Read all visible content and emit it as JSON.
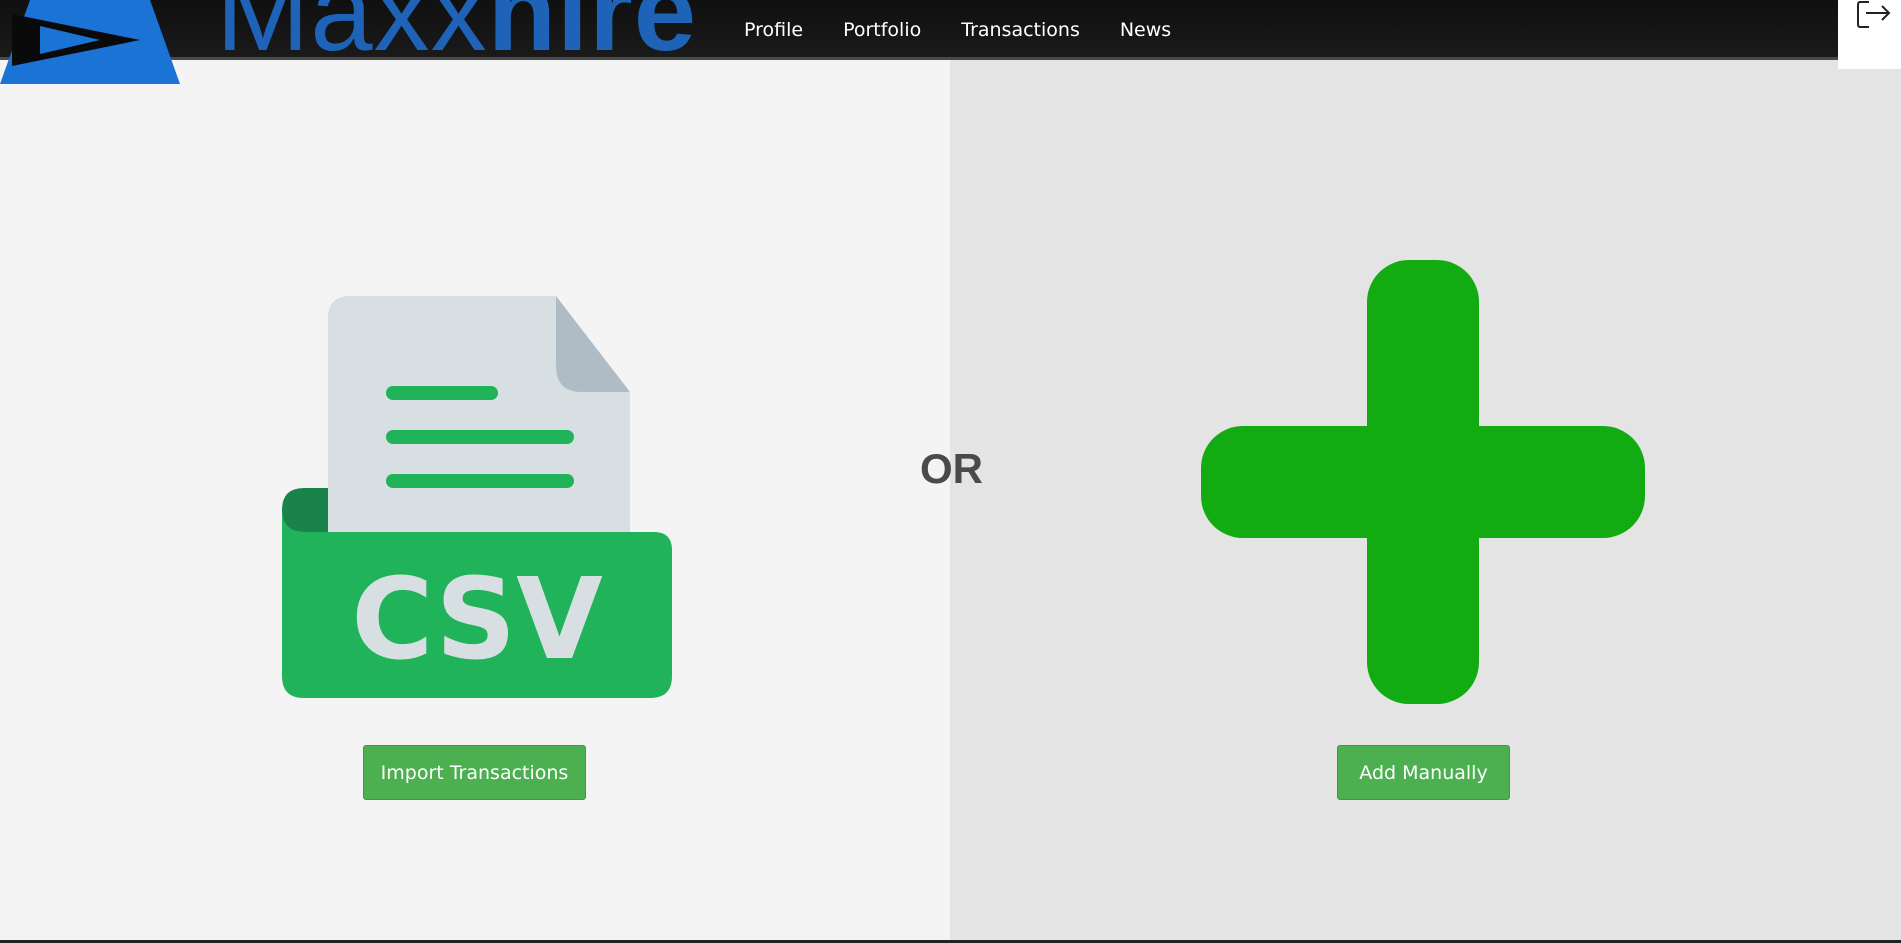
{
  "brand": {
    "logo_regular": "Maxx",
    "logo_bold": "hire"
  },
  "nav": {
    "items": [
      {
        "label": "Profile"
      },
      {
        "label": "Portfolio"
      },
      {
        "label": "Transactions"
      },
      {
        "label": "News"
      }
    ]
  },
  "logout": {
    "icon": "logout-icon"
  },
  "main": {
    "or_label": "OR",
    "import": {
      "icon": "csv-file-icon",
      "icon_text": "CSV",
      "button_label": "Import Transactions"
    },
    "manual": {
      "icon": "plus-icon",
      "button_label": "Add Manually"
    }
  },
  "colors": {
    "navbar": "#141414",
    "button": "#4caf50",
    "csv_green": "#20b35a",
    "plus_green": "#12ab12",
    "logo_blue": "#1e63b8",
    "left_bg": "#f4f4f4",
    "right_bg": "#e4e4e4"
  }
}
